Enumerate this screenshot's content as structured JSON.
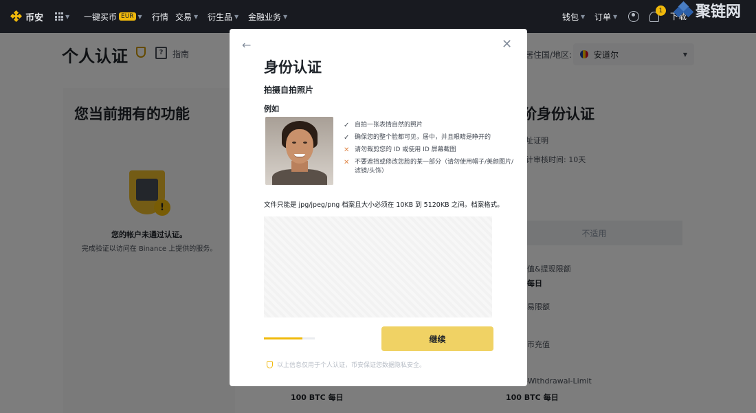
{
  "nav": {
    "logo": "币安",
    "items": [
      {
        "label": "一键买币",
        "badge": "EUR"
      },
      {
        "label": "行情"
      },
      {
        "label": "交易"
      },
      {
        "label": "衍生品"
      },
      {
        "label": "金融业务"
      }
    ],
    "wallet": "钱包",
    "orders": "订单",
    "notifications_count": "1",
    "download": "下载",
    "watermark": "聚链网"
  },
  "page": {
    "title": "个人认证",
    "guide": "指南",
    "country_label": "居住国/地区:",
    "country": "安道尔",
    "left": {
      "heading": "您当前拥有的功能",
      "status": "您的帐户未通过认证。",
      "desc": "完成验证以访问在 Binance 上提供的服务。",
      "limit": "100 BTC 每日"
    },
    "right": {
      "heading": "阶身份认证",
      "proof": "址证明",
      "review_time": "计审核时间: 10天",
      "na_button": "不适用",
      "deposit_limit": "值&提现限额",
      "daily": "每日",
      "trade_limit": "易限额",
      "crypto_deposit": "币充值",
      "withdraw_limit": "-Withdrawal-Limit",
      "limit": "100 BTC 每日"
    }
  },
  "modal": {
    "title": "身份认证",
    "subtitle": "拍摄自拍照片",
    "example_label": "例如",
    "rules": [
      {
        "type": "ok",
        "text": "自拍一张表情自然的照片"
      },
      {
        "type": "ok",
        "text": "确保您的整个脸都可见，居中，并且眼睛是睁开的"
      },
      {
        "type": "no",
        "text": "请勿裁剪您的 ID 或使用 ID 屏幕截图"
      },
      {
        "type": "no",
        "text": "不要遮挡或修改您脸的某一部分（请勿使用帽子/美颜图片/滤镜/头饰）"
      }
    ],
    "file_note": "文件只能是 jpg/jpeg/png 档案且大小必须在 10KB 到 5120KB 之间。档案格式。",
    "continue_label": "继续",
    "privacy": "以上信息仅用于个人认证，币安保证您数据隐私安全。",
    "progress_fraction": 0.75
  }
}
